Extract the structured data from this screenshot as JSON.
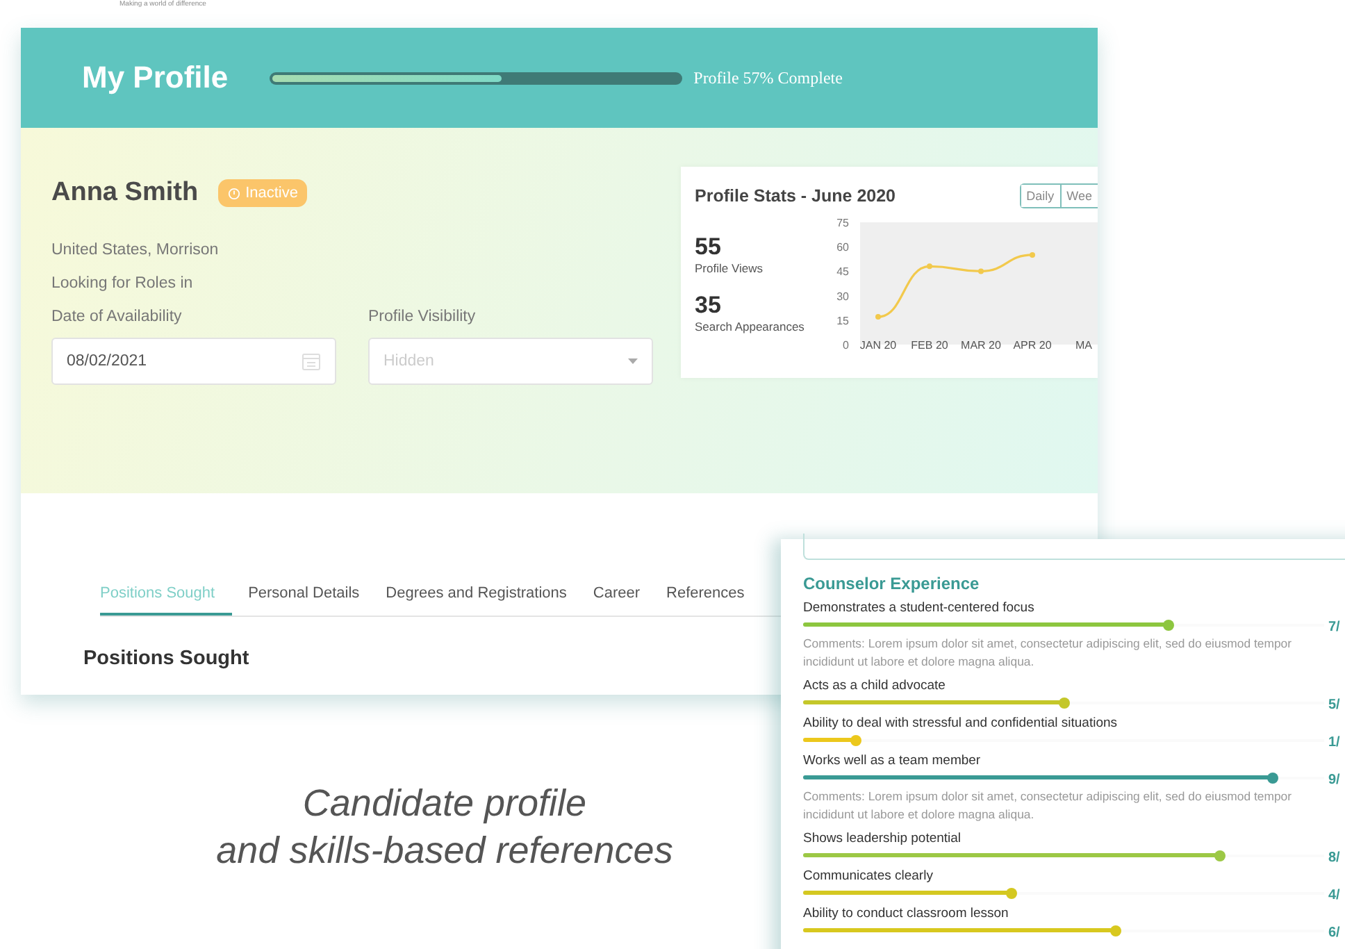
{
  "brand": {
    "tagline": "Making a world of difference"
  },
  "profile_window": {
    "title": "My Profile",
    "progress": {
      "level": 0.57,
      "label": "Profile 57% Complete"
    },
    "person": {
      "name": "Anna Smith",
      "status": "Inactive",
      "location": "United States, Morrison",
      "roles_label": "Looking for Roles in"
    },
    "fields": [
      {
        "label": "Date of Availability",
        "kind": "date",
        "value": "08/02/2021"
      },
      {
        "label": "Profile Visibility",
        "kind": "select",
        "placeholder": "Hidden"
      }
    ],
    "stats": {
      "title": "Profile Stats - June 2020",
      "buttons": [
        "Daily",
        "Wee"
      ],
      "metrics": [
        {
          "value": "55",
          "label": "Profile Views"
        },
        {
          "value": "35",
          "label": "Search Appearances"
        }
      ],
      "chart_data": {
        "type": "line",
        "categories": [
          "JAN 20",
          "FEB 20",
          "MAR 20",
          "APR 20",
          "MA"
        ],
        "yticks": [
          0,
          15,
          30,
          45,
          60,
          75
        ],
        "ylim": [
          0,
          75
        ],
        "series": [
          {
            "color": "#f2c94c",
            "marker": true,
            "values": [
              17,
              48,
              45,
              55,
              null
            ]
          }
        ]
      }
    },
    "tabs": [
      {
        "label": "Positions Sought",
        "selected": true
      },
      {
        "label": "Personal Details",
        "selected": false
      },
      {
        "label": "Degrees and Registrations",
        "selected": false
      },
      {
        "label": "Career",
        "selected": false
      },
      {
        "label": "References",
        "selected": false
      }
    ],
    "section_heading": "Positions Sought"
  },
  "references_window": {
    "section": "Counselor Experience",
    "items": [
      {
        "kind": "rating",
        "label": "Demonstrates a student-centered focus",
        "level": 0.7,
        "score": "7/",
        "color": "#8dc63f"
      },
      {
        "kind": "comment",
        "text": "Comments: Lorem ipsum dolor sit amet, consectetur adipiscing elit, sed do eiusmod tempor incididunt ut labore et dolore magna aliqua."
      },
      {
        "kind": "rating",
        "label": "Acts as a child advocate",
        "level": 0.5,
        "score": "5/",
        "color": "#c4c72a"
      },
      {
        "kind": "rating",
        "label": "Ability to deal with stressful and confidential situations",
        "level": 0.1,
        "score": "1/",
        "color": "#ecc81c"
      },
      {
        "kind": "rating",
        "label": "Works well as a team member",
        "level": 0.9,
        "score": "9/",
        "color": "#3a9a94"
      },
      {
        "kind": "comment",
        "text": "Comments: Lorem ipsum dolor sit amet, consectetur adipiscing elit, sed do eiusmod tempor incididunt ut labore et dolore magna aliqua."
      },
      {
        "kind": "rating",
        "label": "Shows leadership potential",
        "level": 0.8,
        "score": "8/",
        "color": "#9cc845"
      },
      {
        "kind": "rating",
        "label": "Communicates clearly",
        "level": 0.4,
        "score": "4/",
        "color": "#d4c821"
      },
      {
        "kind": "rating",
        "label": "Ability to conduct classroom lesson",
        "level": 0.6,
        "score": "6/",
        "color": "#d8c81e"
      }
    ]
  },
  "caption": [
    "Candidate profile",
    "and skills-based references"
  ]
}
